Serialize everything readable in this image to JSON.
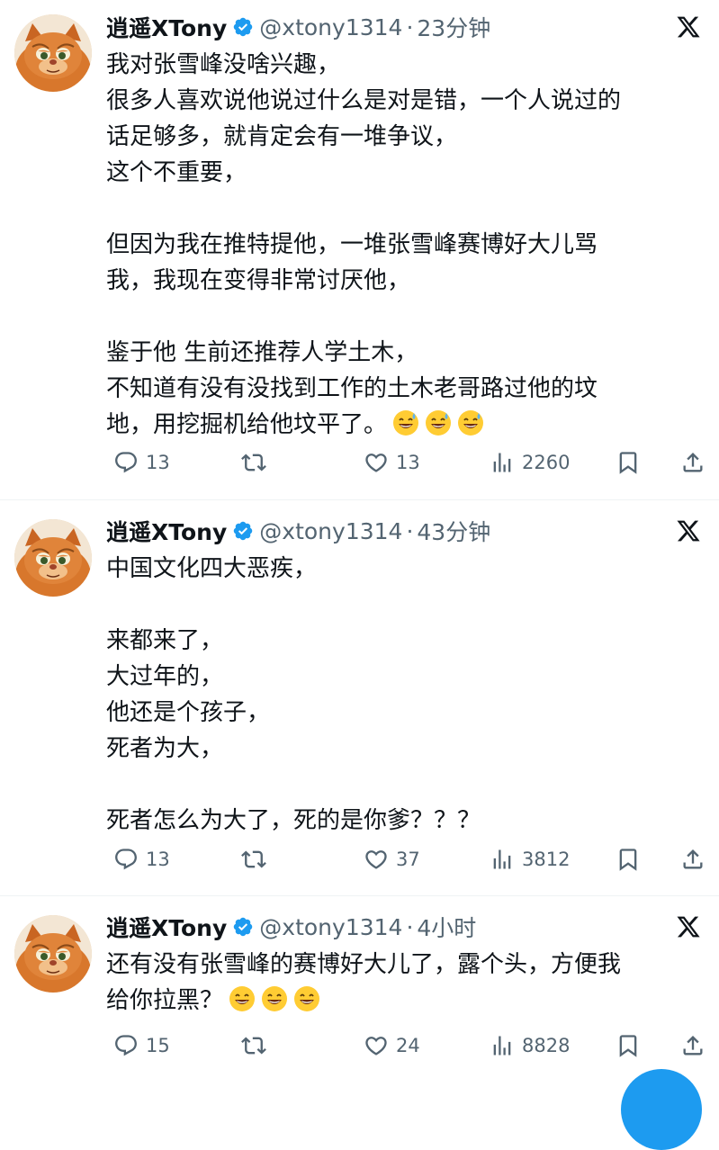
{
  "tweets": [
    {
      "name": "逍遥XTony",
      "handle": "@xtony1314",
      "separator": "·",
      "time": "23分钟",
      "lines": [
        "我对张雪峰没啥兴趣，",
        "很多人喜欢说他说过什么是对是错，一个人说过的",
        "话足够多，就肯定会有一堆争议，",
        "这个不重要，",
        "",
        "但因为我在推特提他，一堆张雪峰赛博好大儿骂",
        "我，我现在变得非常讨厌他，",
        "",
        "鉴于他 生前还推荐人学土木，",
        "不知道有没有没找到工作的土木老哥路过他的坟",
        "地，用挖掘机给他坟平了。"
      ],
      "emoji": "grinning-sweat-face",
      "emoji_count": 3,
      "replies": "13",
      "likes": "13",
      "views": "2260"
    },
    {
      "name": "逍遥XTony",
      "handle": "@xtony1314",
      "separator": "·",
      "time": "43分钟",
      "lines": [
        "中国文化四大恶疾，",
        "",
        "来都来了，",
        "大过年的，",
        "他还是个孩子，",
        "死者为大，",
        "",
        "死者怎么为大了，死的是你爹？？？"
      ],
      "replies": "13",
      "likes": "37",
      "views": "3812"
    },
    {
      "name": "逍遥XTony",
      "handle": "@xtony1314",
      "separator": "·",
      "time": "4小时",
      "lines": [
        "还有没有张雪峰的赛博好大儿了，露个头，方便我",
        "给你拉黑？"
      ],
      "emoji": "grinning-face",
      "emoji_count": 3,
      "replies": "15",
      "likes": "24",
      "views": "8828"
    }
  ],
  "colors": {
    "text": "#0f1419",
    "secondary": "#536471",
    "verified": "#1d9bf0",
    "divider": "#eff3f4"
  },
  "icons": [
    "reply-icon",
    "retweet-icon",
    "like-icon",
    "views-icon",
    "bookmark-icon",
    "share-icon",
    "x-logo-icon",
    "verified-badge-icon"
  ]
}
